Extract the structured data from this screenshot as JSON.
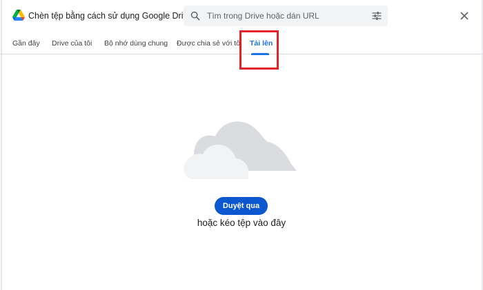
{
  "header": {
    "title": "Chèn tệp bằng cách sử dụng Google Drive",
    "search_placeholder": "Tìm trong Drive hoặc dán URL",
    "search_value": ""
  },
  "tabs": [
    {
      "label": "Gần đây",
      "active": false
    },
    {
      "label": "Drive của tôi",
      "active": false
    },
    {
      "label": "Bộ nhớ dùng chung",
      "active": false
    },
    {
      "label": "Được chia sẻ với tôi",
      "active": false
    },
    {
      "label": "Tải lên",
      "active": true
    }
  ],
  "upload": {
    "browse_label": "Duyệt qua",
    "drag_text": "hoặc kéo tệp vào đây"
  },
  "icons": {
    "logo": "google-drive-icon",
    "search": "search-icon",
    "filter": "filter-sliders-icon",
    "close": "close-icon",
    "illustration": "cloud-icon"
  },
  "colors": {
    "accent": "#1a73e8",
    "button": "#0b57d0",
    "annotation": "#e52329",
    "search_bg": "#f1f3f4"
  }
}
